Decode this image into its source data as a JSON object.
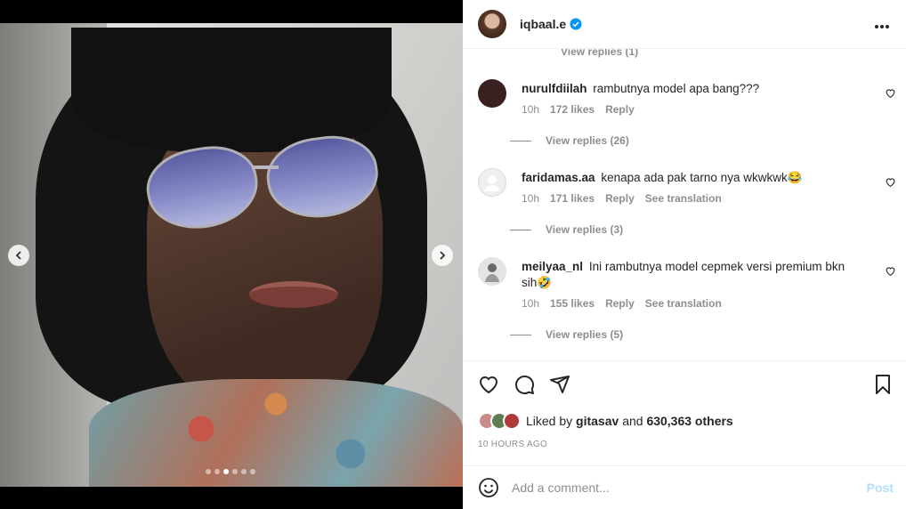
{
  "post": {
    "username": "iqbaal.e",
    "carousel_dot_count": 6,
    "carousel_active_index": 2
  },
  "comments": {
    "clipped_replies_text": "View replies (1)",
    "items": [
      {
        "username": "nurulfdiilah",
        "text": "rambutnya model apa bang???",
        "time": "10h",
        "likes": "172 likes",
        "reply": "Reply",
        "translation": "",
        "view_replies": "View replies (26)",
        "avatar_color": "#3a2020"
      },
      {
        "username": "faridamas.aa",
        "text": "kenapa ada pak tarno nya wkwkwk😂",
        "time": "10h",
        "likes": "171 likes",
        "reply": "Reply",
        "translation": "See translation",
        "view_replies": "View replies (3)",
        "avatar_color": "#e9e9e9"
      },
      {
        "username": "meilyaa_nl",
        "text": "Ini rambutnya model cepmek versi premium bkn sih🤣",
        "time": "10h",
        "likes": "155 likes",
        "reply": "Reply",
        "translation": "See translation",
        "view_replies": "View replies (5)",
        "avatar_color": "#d8d8d8"
      }
    ]
  },
  "likes": {
    "prefix": "Liked by",
    "user": "gitasav",
    "joiner": "and",
    "others": "630,363 others"
  },
  "timestamp": "10 HOURS AGO",
  "add_comment": {
    "placeholder": "Add a comment...",
    "post_label": "Post"
  },
  "colors": {
    "accent_verified": "#0095f6",
    "post_disabled": "#b2dffc",
    "meta_gray": "#8e8e8e"
  }
}
